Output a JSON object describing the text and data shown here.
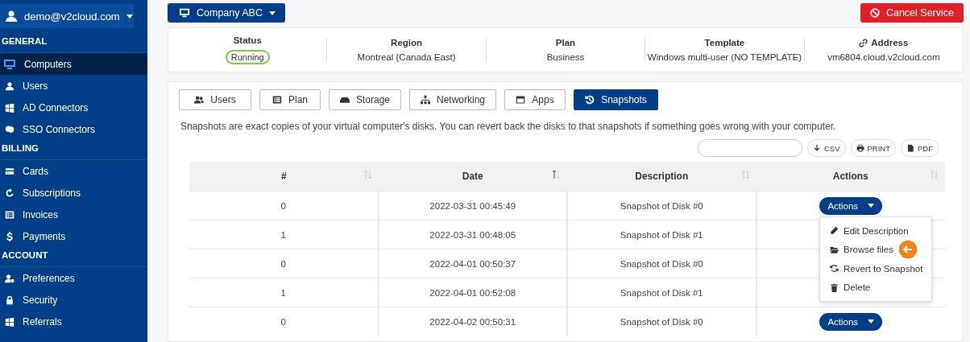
{
  "account": {
    "email": "demo@v2cloud.com"
  },
  "sidebar": {
    "sections": [
      {
        "title": "GENERAL",
        "items": [
          {
            "label": "Computers",
            "selected": true
          },
          {
            "label": "Users",
            "selected": false
          },
          {
            "label": "AD Connectors",
            "selected": false
          },
          {
            "label": "SSO Connectors",
            "selected": false
          }
        ]
      },
      {
        "title": "BILLING",
        "items": [
          {
            "label": "Cards",
            "selected": false
          },
          {
            "label": "Subscriptions",
            "selected": false
          },
          {
            "label": "Invoices",
            "selected": false
          },
          {
            "label": "Payments",
            "selected": false
          }
        ]
      },
      {
        "title": "ACCOUNT",
        "items": [
          {
            "label": "Preferences",
            "selected": false
          },
          {
            "label": "Security",
            "selected": false
          },
          {
            "label": "Referrals",
            "selected": false
          }
        ]
      }
    ]
  },
  "company_button": "Company ABC",
  "cancel_button": "Cancel Service",
  "info": [
    {
      "label": "Status",
      "value": "Running",
      "kind": "badge"
    },
    {
      "label": "Region",
      "value": "Montreal (Canada East)",
      "kind": "text"
    },
    {
      "label": "Plan",
      "value": "Business",
      "kind": "text"
    },
    {
      "label": "Template",
      "value": "Windows multi-user (NO TEMPLATE)",
      "kind": "text"
    },
    {
      "label": "Address",
      "value": "vm6804.cloud.v2cloud.com",
      "kind": "link"
    }
  ],
  "tabs": [
    {
      "label": "Users",
      "selected": false
    },
    {
      "label": "Plan",
      "selected": false
    },
    {
      "label": "Storage",
      "selected": false
    },
    {
      "label": "Networking",
      "selected": false
    },
    {
      "label": "Apps",
      "selected": false
    },
    {
      "label": "Snapshots",
      "selected": true
    }
  ],
  "description": "Snapshots are exact copies of your virtual computer's disks. You can revert back the disks to that snapshots if something goes wrong with your computer.",
  "export_buttons": [
    "CSV",
    "PRINT",
    "PDF"
  ],
  "table": {
    "columns": [
      {
        "label": "#",
        "sorted": false
      },
      {
        "label": "Date",
        "sorted": true
      },
      {
        "label": "Description",
        "sorted": false
      },
      {
        "label": "Actions",
        "sorted": false
      }
    ],
    "rows": [
      {
        "number": "0",
        "date": "2022-03-31 00:45:49",
        "description": "Snapshot of Disk #0",
        "action": "Actions"
      },
      {
        "number": "1",
        "date": "2022-03-31 00:48:05",
        "description": "Snapshot of Disk #1"
      },
      {
        "number": "0",
        "date": "2022-04-01 00:50:37",
        "description": "Snapshot of Disk #0"
      },
      {
        "number": "1",
        "date": "2022-04-01 00:52:08",
        "description": "Snapshot of Disk #1"
      },
      {
        "number": "0",
        "date": "2022-04-02 00:50:31",
        "description": "Snapshot of Disk #0",
        "action": "Actions"
      }
    ]
  },
  "actions_menu": {
    "items": [
      "Edit Description",
      "Browse files",
      "Revert to Snapshot",
      "Delete"
    ]
  }
}
